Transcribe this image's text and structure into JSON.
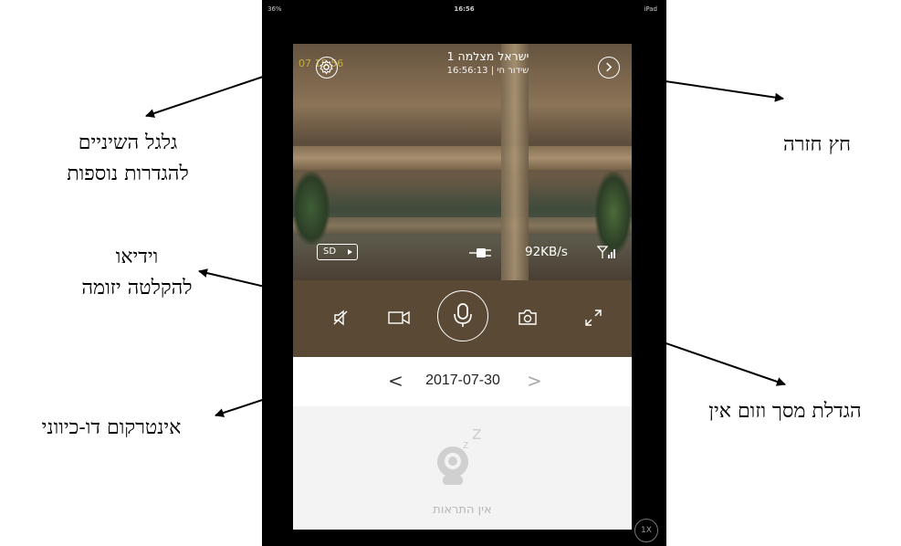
{
  "annotations": {
    "settings_gear_line1": "גלגל השיניים",
    "settings_gear_line2": "להגדרות נוספות",
    "back_arrow": "חץ חזרה",
    "video_record_line1": "וידיאו",
    "video_record_line2": "להקלטה יזומה",
    "intercom": "אינטרקום דו-כיווני",
    "fullscreen_zoom": "הגדלת מסך וזום אין"
  },
  "status_bar": {
    "battery": "36%",
    "time": "16:56",
    "device": "iPad"
  },
  "video": {
    "camera_name": "ישראל מצלמה 1",
    "live_label": "שידור חי | 16:56:13",
    "overlay_timestamp": "07 15:56",
    "quality_label": "SD",
    "bitrate": "92KB/s",
    "signal_icon": "wifi-signal-icon"
  },
  "controls": {
    "icons": [
      "mute-icon",
      "video-record-icon",
      "microphone-icon",
      "camera-snapshot-icon",
      "fullscreen-expand-icon"
    ]
  },
  "timeline": {
    "date": "2017-07-30",
    "prev_symbol": "<",
    "next_symbol": ">"
  },
  "events": {
    "empty_text": "אין התראות"
  },
  "playback_speed": "1X",
  "colors": {
    "control_bar": "#5a4a35",
    "frame": "#000000",
    "empty_text": "#b8b8b8"
  }
}
